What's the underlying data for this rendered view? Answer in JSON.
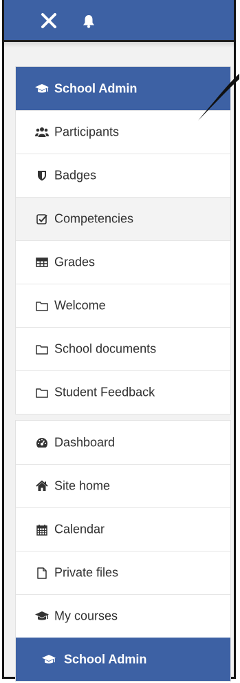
{
  "nav": {
    "course_items": [
      {
        "label": "School Admin",
        "icon": "graduation-cap-icon"
      },
      {
        "label": "Participants",
        "icon": "users-icon"
      },
      {
        "label": "Badges",
        "icon": "shield-icon"
      },
      {
        "label": "Competencies",
        "icon": "checkbox-icon"
      },
      {
        "label": "Grades",
        "icon": "table-icon"
      },
      {
        "label": "Welcome",
        "icon": "folder-icon"
      },
      {
        "label": "School documents",
        "icon": "folder-icon"
      },
      {
        "label": "Student Feedback",
        "icon": "folder-icon"
      }
    ],
    "site_items": [
      {
        "label": "Dashboard",
        "icon": "dashboard-icon"
      },
      {
        "label": "Site home",
        "icon": "home-icon"
      },
      {
        "label": "Calendar",
        "icon": "calendar-icon"
      },
      {
        "label": "Private files",
        "icon": "file-icon"
      },
      {
        "label": "My courses",
        "icon": "graduation-cap-icon"
      },
      {
        "label": "School Admin",
        "icon": "graduation-cap-icon"
      }
    ]
  },
  "colors": {
    "accent": "#3d61a4",
    "active_text": "#ffffff",
    "text": "#303030"
  }
}
